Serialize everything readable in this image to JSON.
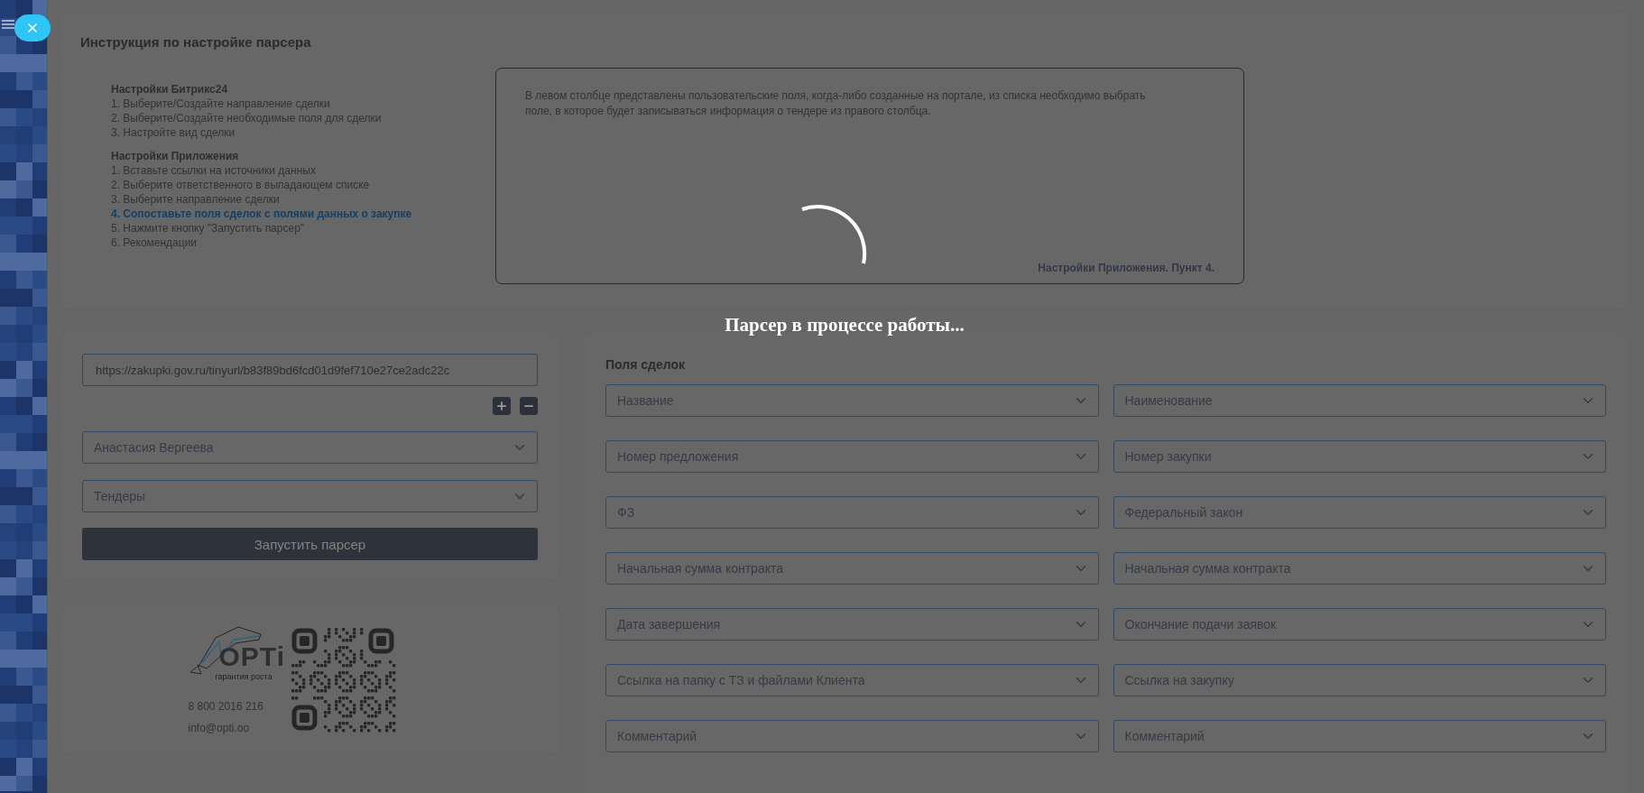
{
  "instructions": {
    "title": "Инструкция по настройке парсера",
    "sections": [
      {
        "heading": "Настройки Битрикс24",
        "items": [
          {
            "text": "1. Выберите/Создайте направление сделки",
            "selected": false
          },
          {
            "text": "2. Выберите/Создайте необходимые поля для сделки",
            "selected": false
          },
          {
            "text": "3. Настройте вид сделки",
            "selected": false
          }
        ]
      },
      {
        "heading": "Настройки Приложения",
        "items": [
          {
            "text": "1. Вставьте ссылки на источники данных",
            "selected": false
          },
          {
            "text": "2. Выберите ответственного в выпадающем списке",
            "selected": false
          },
          {
            "text": "3. Выберите направление сделки",
            "selected": false
          },
          {
            "text": "4. Сопоставьте поля сделок с полями данных о закупке",
            "selected": true
          },
          {
            "text": "5. Нажмите кнопку \"Запустить парсер\"",
            "selected": false
          },
          {
            "text": "6. Рекомендации",
            "selected": false
          }
        ]
      }
    ]
  },
  "hint": {
    "text": "В левом столбце представлены пользовательские поля, когда-либо созданные на портале, из списка необходимо выбрать поле, в которое будет записываться информация о тендере из правого столбца.",
    "caption": "Настройки Приложения. Пункт 4."
  },
  "overlay": {
    "text": "Парсер в процессе работы..."
  },
  "form": {
    "url": "https://zakupki.gov.ru/tinyurl/b83f89bd6fcd01d9fef710e27ce2adc22c",
    "responsible": "Анастасия Вергеева",
    "direction": "Тендеры",
    "start_button": "Запустить парсер"
  },
  "contacts": {
    "logo_word": "OPTi",
    "logo_tagline": "гарантия роста",
    "phone": "8 800 2016 216",
    "email": "info@opti.oo"
  },
  "deal_fields": {
    "title": "Поля сделок",
    "rows": [
      {
        "deal_field": "Название",
        "tender_field": "Наименование"
      },
      {
        "deal_field": "Номер предложения",
        "tender_field": "Номер закупки"
      },
      {
        "deal_field": "ФЗ",
        "tender_field": "Федеральный закон"
      },
      {
        "deal_field": "Начальная сумма контракта",
        "tender_field": "Начальная сумма контракта"
      },
      {
        "deal_field": "Дата завершения",
        "tender_field": "Окончание подачи заявок"
      },
      {
        "deal_field": "Ссылка на папку с ТЗ и файлами Клиента",
        "tender_field": "Ссылка на закупку"
      },
      {
        "deal_field": "Комментарий",
        "tender_field": "Комментарий"
      }
    ]
  }
}
